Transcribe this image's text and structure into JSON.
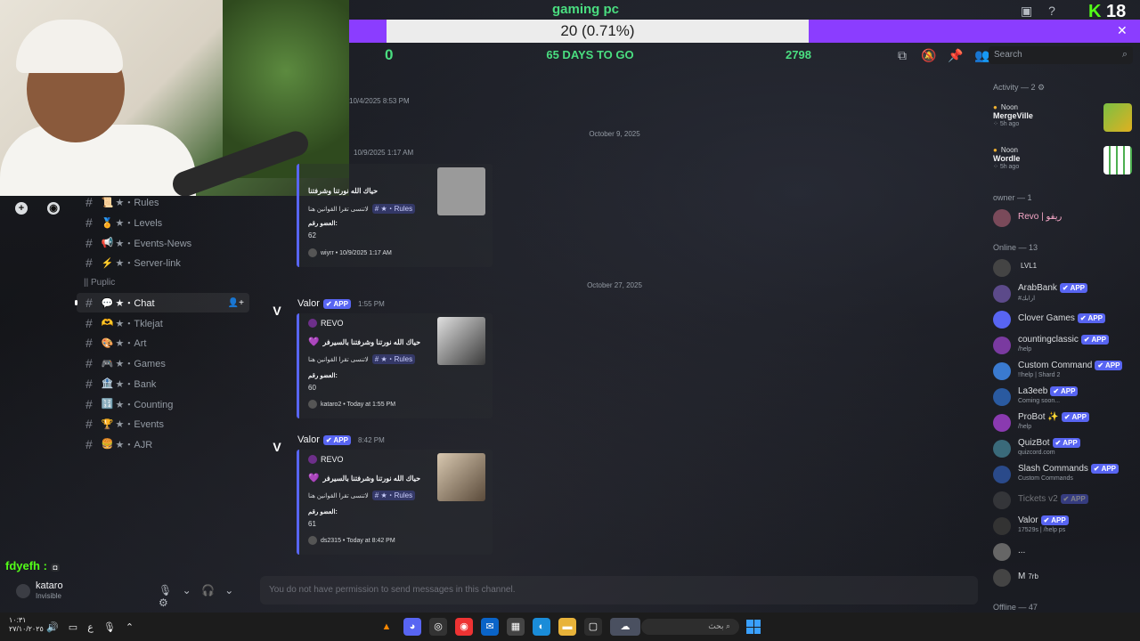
{
  "overlay": {
    "goal_title": "gaming pc",
    "goal_progress": "20 (0.71%)",
    "goal_fraction": 0.0071,
    "goal_start": "0",
    "goal_days": "65 DAYS TO GO",
    "goal_end": "2798",
    "kick_count": "18",
    "chat_user": "fdyefh :"
  },
  "search": {
    "placeholder": "Search"
  },
  "channels": [
    {
      "emoji": "📜",
      "name": "★・Rules"
    },
    {
      "emoji": "🏅",
      "name": "★・Levels"
    },
    {
      "emoji": "📢",
      "name": "★・Events-News"
    },
    {
      "emoji": "⚡",
      "name": "★・Server-link"
    }
  ],
  "category": "|| Puplic",
  "public_channels": [
    {
      "emoji": "💬",
      "name": "★・Chat",
      "active": true
    },
    {
      "emoji": "🫶",
      "name": "★・Tklejat"
    },
    {
      "emoji": "🎨",
      "name": "★・Art"
    },
    {
      "emoji": "🎮",
      "name": "★・Games"
    },
    {
      "emoji": "🏦",
      "name": "★・Bank"
    },
    {
      "emoji": "🔢",
      "name": "★・Counting"
    },
    {
      "emoji": "🏆",
      "name": "★・Events"
    },
    {
      "emoji": "🍔",
      "name": "★・AJR"
    }
  ],
  "user": {
    "name": "kataro",
    "status": "Invisible"
  },
  "messages": {
    "ts_top": "10/4/2025 8:53 PM",
    "date1": "October 9, 2025",
    "ts_mid": "10/9/2025 1:17 AM",
    "embed1": {
      "title": "حياك الله نورتنا وشرفتنا",
      "rule_text": "لاتنسى تقرا القوانين هنا",
      "rule_mention": "★・Rules",
      "field": "العضو رقم:",
      "value": "62",
      "footer": "wiyrr • 10/9/2025 1:17 AM"
    },
    "date2": "October 27, 2025",
    "msg2": {
      "author": "Valor",
      "badge": "APP",
      "time": "1:55 PM",
      "embed_author": "REVO",
      "title": "حياك الله نورتنا وشرفتنا بالسيرفر",
      "rule_text": "لاتنسى تقرا القوانين هنا",
      "rule_mention": "★・Rules",
      "field": "العضو رقم:",
      "value": "60",
      "footer": "kataro2 • Today at 1:55 PM"
    },
    "msg3": {
      "author": "Valor",
      "badge": "APP",
      "time": "8:42 PM",
      "embed_author": "REVO",
      "title": "حياك الله نورتنا وشرفتنا بالسيرفر",
      "rule_text": "لاتنسى تقرا القوانين هنا",
      "rule_mention": "★・Rules",
      "field": "العضو رقم:",
      "value": "61",
      "footer": "ds2315 • Today at 8:42 PM"
    },
    "composer": "You do not have permission to send messages in this channel."
  },
  "members": {
    "activity_head": "Activity — 2",
    "activities": [
      {
        "user": "Noon",
        "game": "MergeVille",
        "time": "5h ago"
      },
      {
        "user": "Noon",
        "game": "Wordle",
        "time": "5h ago"
      }
    ],
    "owner_head": "owner — 1",
    "owner": {
      "name": "Revo | ريفو"
    },
    "online_head": "Online — 13",
    "online": [
      {
        "name": "",
        "tag": "LVL1",
        "sub": ""
      },
      {
        "name": "ArabBank",
        "badge": "APP",
        "sub": "#ارابك"
      },
      {
        "name": "Clover Games",
        "badge": "APP",
        "sub": ""
      },
      {
        "name": "countingclassic",
        "badge": "APP",
        "sub": "/help"
      },
      {
        "name": "Custom Command",
        "badge": "APP",
        "sub": "!!help | Shard 2"
      },
      {
        "name": "La3eeb",
        "badge": "APP",
        "sub": "Coming soon..."
      },
      {
        "name": "ProBot ✨",
        "badge": "APP",
        "sub": "/help"
      },
      {
        "name": "QuizBot",
        "badge": "APP",
        "sub": "quizcord.com"
      },
      {
        "name": "Slash Commands",
        "badge": "APP",
        "sub": "Custom Commands"
      },
      {
        "name": "Tickets v2",
        "badge": "APP",
        "sub": ""
      },
      {
        "name": "Valor",
        "badge": "APP",
        "sub": "17529s | /help ps"
      },
      {
        "name": "...",
        "sub": ""
      },
      {
        "name": "M",
        "tag": "7rb",
        "sub": ""
      }
    ],
    "offline_head": "Offline — 47"
  },
  "taskbar": {
    "time": "١٠:٣١",
    "date": "٢٧/١٠/٢٠٢٥",
    "lang": "ع",
    "search": "بحث"
  }
}
